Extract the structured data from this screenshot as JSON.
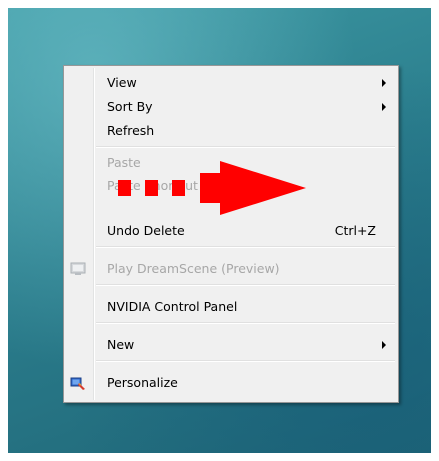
{
  "menu": {
    "items": [
      {
        "label": "View",
        "submenu": true
      },
      {
        "label": "Sort By",
        "submenu": true
      },
      {
        "label": "Refresh"
      },
      {
        "label": "Paste",
        "disabled": true
      },
      {
        "label": "Paste Shortcut",
        "disabled": true
      },
      {
        "label": "Undo Delete",
        "shortcut": "Ctrl+Z"
      },
      {
        "label": "Play DreamScene (Preview)",
        "disabled": true,
        "icon": "dreamscene-icon"
      },
      {
        "label": "NVIDIA Control Panel"
      },
      {
        "label": "New",
        "submenu": true
      },
      {
        "label": "Personalize",
        "icon": "personalize-icon"
      }
    ]
  },
  "annotation": {
    "icon": "red-dashed-arrow-icon",
    "color": "#ff0000"
  },
  "colors": {
    "menu_bg": "#f0f0f0",
    "disabled_text": "#a7a7a7"
  }
}
